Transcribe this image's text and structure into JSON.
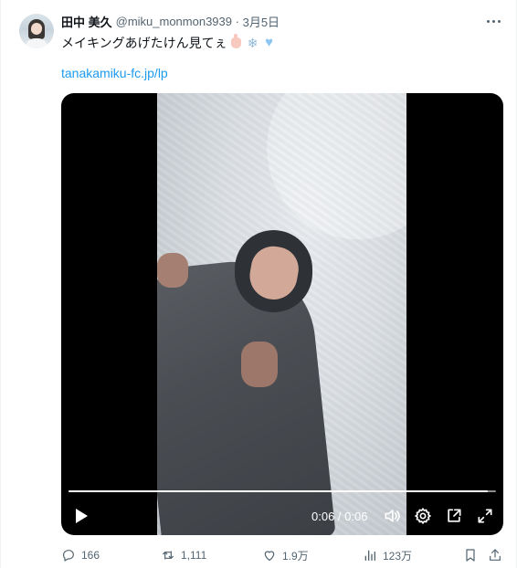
{
  "tweet": {
    "author_name": "田中 美久",
    "handle": "@miku_monmon3939",
    "separator": "·",
    "date": "3月5日",
    "text": "メイキングあげたけん見てぇ",
    "emojis": [
      "pointing-down-hand",
      "snowflake",
      "light-blue-heart"
    ],
    "link": "tanakamiku-fc.jp/lp"
  },
  "video": {
    "time_display": "0:06 / 0:06",
    "progress": 0.98,
    "controls": [
      "play-icon",
      "volume-icon",
      "settings-icon",
      "picture-in-picture-icon",
      "fullscreen-icon"
    ]
  },
  "actions": {
    "replies": "166",
    "retweets": "1,111",
    "likes": "1.9万",
    "views": "123万"
  },
  "colors": {
    "link": "#1d9bf0",
    "muted": "#536471",
    "text": "#0f1419"
  }
}
